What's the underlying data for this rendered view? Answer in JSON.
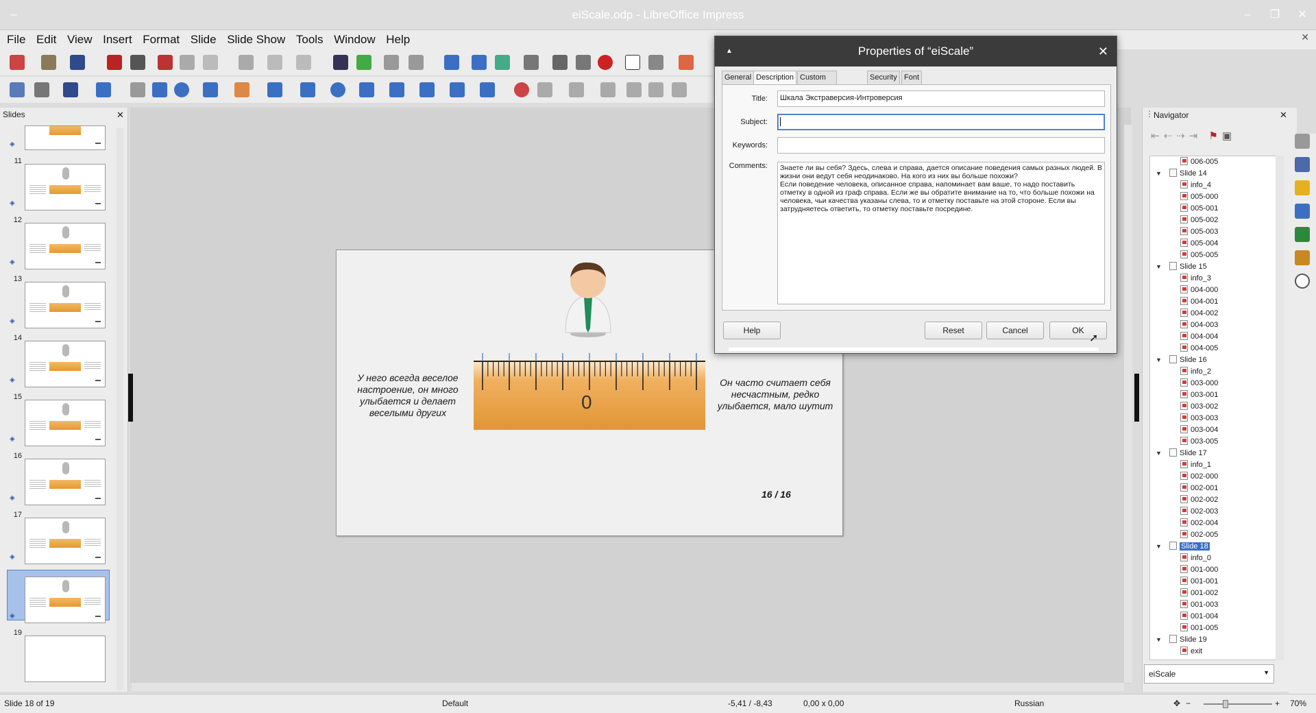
{
  "window": {
    "title": "eiScale.odp - LibreOffice Impress"
  },
  "menu": [
    "File",
    "Edit",
    "View",
    "Insert",
    "Format",
    "Slide",
    "Slide Show",
    "Tools",
    "Window",
    "Help"
  ],
  "slides_panel": {
    "title": "Slides",
    "slides": [
      {
        "num": "11"
      },
      {
        "num": "12"
      },
      {
        "num": "13"
      },
      {
        "num": "14"
      },
      {
        "num": "15"
      },
      {
        "num": "16"
      },
      {
        "num": "17"
      },
      {
        "num": "18",
        "selected": true
      },
      {
        "num": "19"
      }
    ]
  },
  "slide": {
    "left_text": "У него всегда веселое настроение, он много улыбается и делает веселыми других",
    "right_text": "Он часто считает себя несчастным, редко улыбается, мало шутит",
    "scale_zero": "0",
    "page": "16 / 16"
  },
  "dialog": {
    "title": "Properties of “eiScale”",
    "tabs": [
      "General",
      "Description",
      "Custom Properties",
      "Security",
      "Font"
    ],
    "active_tab": "Description",
    "fields": {
      "title_label": "Title:",
      "title_value": "Шкала Экстраверсия-Интроверсия",
      "subject_label": "Subject:",
      "subject_value": "",
      "keywords_label": "Keywords:",
      "keywords_value": "",
      "comments_label": "Comments:",
      "comments_value": "Знаете ли вы себя? Здесь, слева и справа, дается описание поведения самых разных людей. В жизни они ведут себя неодинаково. На кого из них вы больше похожи?\nЕсли поведение человека, описанное справа, напоминает вам ваше, то надо поставить отметку в одной из граф справа. Если же вы обратите внимание на то, что больше похожи на человека, чьи качества указаны слева, то и отметку поставьте на этой стороне. Если вы затрудняетесь ответить, то отметку поставьте посредине."
    },
    "buttons": {
      "help": "Help",
      "reset": "Reset",
      "cancel": "Cancel",
      "ok": "OK"
    }
  },
  "navigator": {
    "title": "Navigator",
    "document": "eiScale",
    "tree": [
      {
        "label": "006-005",
        "level": 2
      },
      {
        "label": "Slide 14",
        "level": 1
      },
      {
        "label": "info_4",
        "level": 2
      },
      {
        "label": "005-000",
        "level": 2
      },
      {
        "label": "005-001",
        "level": 2
      },
      {
        "label": "005-002",
        "level": 2
      },
      {
        "label": "005-003",
        "level": 2
      },
      {
        "label": "005-004",
        "level": 2
      },
      {
        "label": "005-005",
        "level": 2
      },
      {
        "label": "Slide 15",
        "level": 1
      },
      {
        "label": "info_3",
        "level": 2
      },
      {
        "label": "004-000",
        "level": 2
      },
      {
        "label": "004-001",
        "level": 2
      },
      {
        "label": "004-002",
        "level": 2
      },
      {
        "label": "004-003",
        "level": 2
      },
      {
        "label": "004-004",
        "level": 2
      },
      {
        "label": "004-005",
        "level": 2
      },
      {
        "label": "Slide 16",
        "level": 1
      },
      {
        "label": "info_2",
        "level": 2
      },
      {
        "label": "003-000",
        "level": 2
      },
      {
        "label": "003-001",
        "level": 2
      },
      {
        "label": "003-002",
        "level": 2
      },
      {
        "label": "003-003",
        "level": 2
      },
      {
        "label": "003-004",
        "level": 2
      },
      {
        "label": "003-005",
        "level": 2
      },
      {
        "label": "Slide 17",
        "level": 1
      },
      {
        "label": "info_1",
        "level": 2
      },
      {
        "label": "002-000",
        "level": 2
      },
      {
        "label": "002-001",
        "level": 2
      },
      {
        "label": "002-002",
        "level": 2
      },
      {
        "label": "002-003",
        "level": 2
      },
      {
        "label": "002-004",
        "level": 2
      },
      {
        "label": "002-005",
        "level": 2
      },
      {
        "label": "Slide 18",
        "level": 1,
        "selected": true
      },
      {
        "label": "info_0",
        "level": 2
      },
      {
        "label": "001-000",
        "level": 2
      },
      {
        "label": "001-001",
        "level": 2
      },
      {
        "label": "001-002",
        "level": 2
      },
      {
        "label": "001-003",
        "level": 2
      },
      {
        "label": "001-004",
        "level": 2
      },
      {
        "label": "001-005",
        "level": 2
      },
      {
        "label": "Slide 19",
        "level": 1
      },
      {
        "label": "exit",
        "level": 2
      }
    ]
  },
  "statusbar": {
    "slide_info": "Slide 18 of 19",
    "layout": "Default",
    "position": "-5,41 / -8,43",
    "size": "0,00 x 0,00",
    "language": "Russian",
    "zoom": "70%"
  },
  "colors": {
    "accent": "#3a6fc4",
    "ruler": "#e8a040",
    "dialog_title_bg": "#3b3b3b"
  }
}
